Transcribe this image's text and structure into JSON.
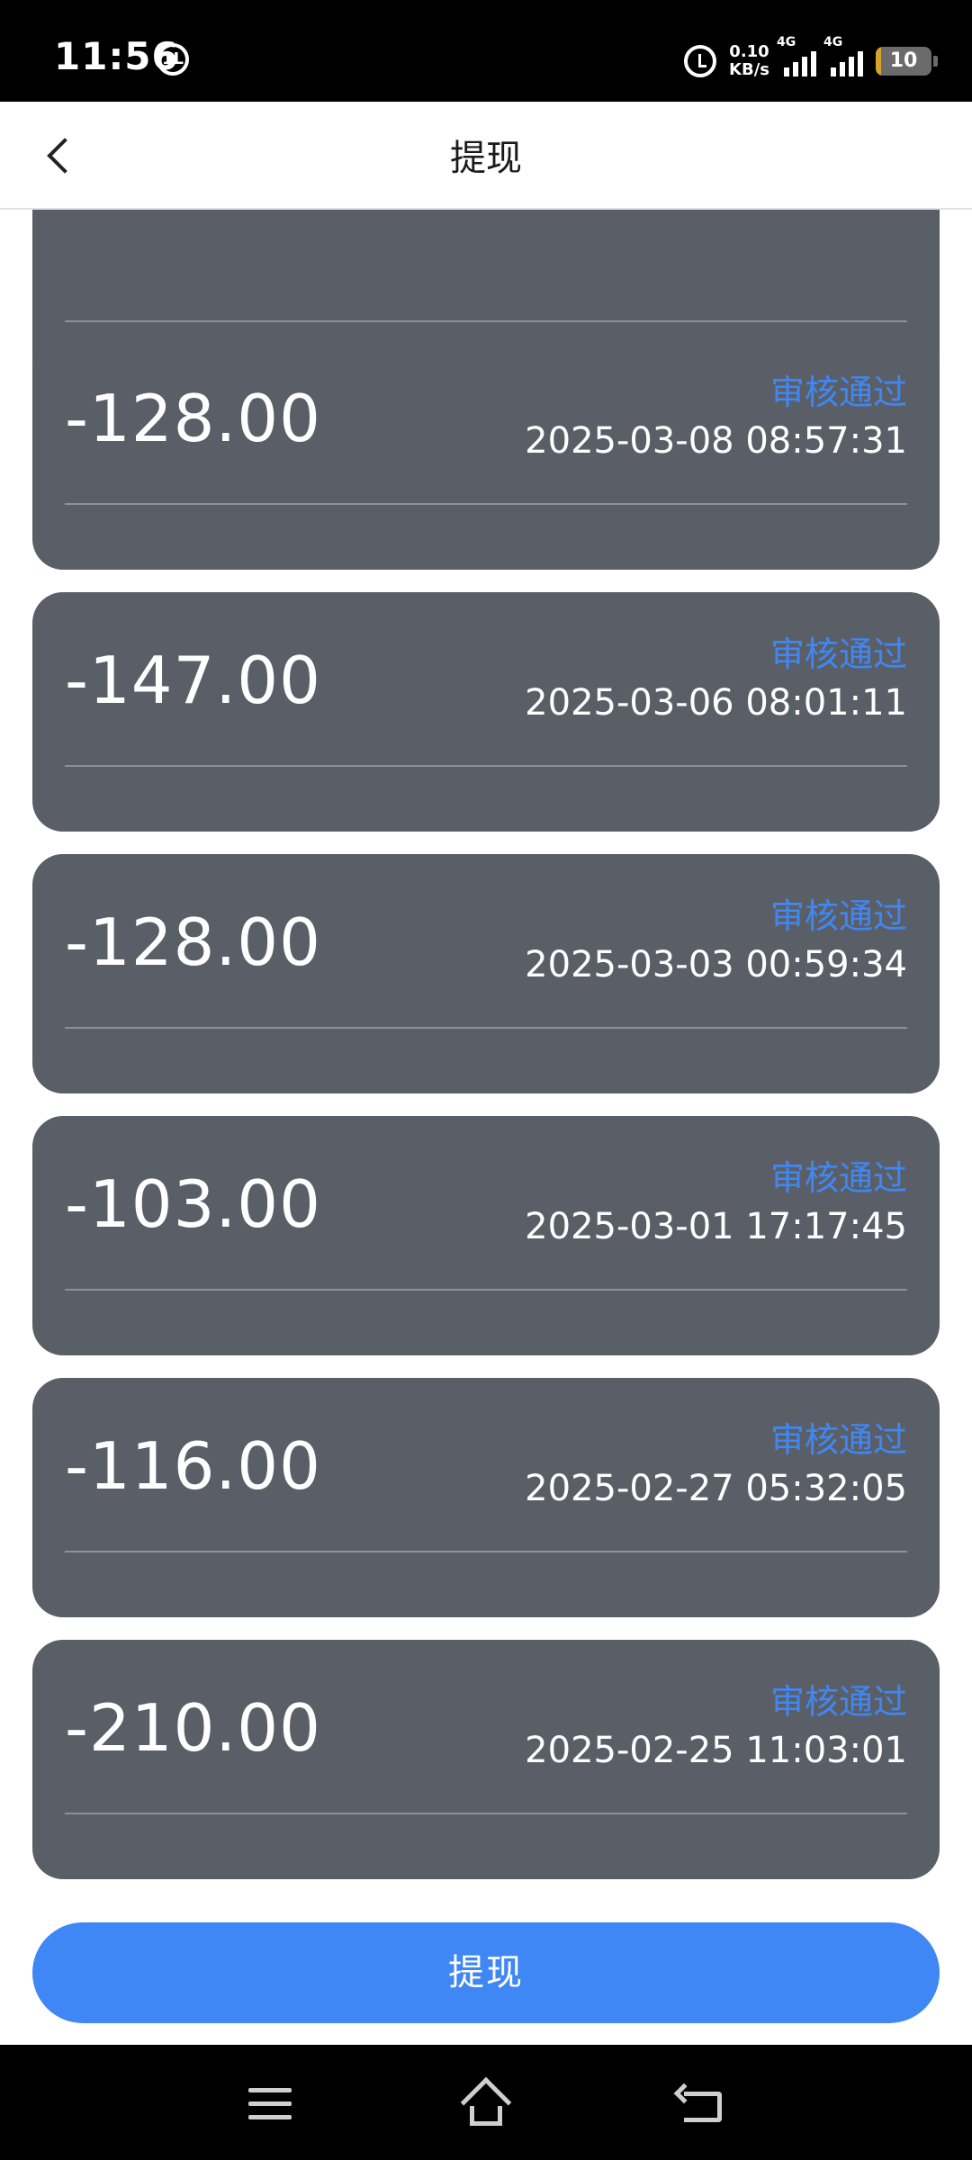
{
  "status_bar": {
    "time": "11:56",
    "notification_glyph": "1L",
    "net_speed_value": "0.10",
    "net_speed_unit": "KB/s",
    "sim1_label": "4G",
    "sim2_label": "4G",
    "battery_level": "10",
    "battery_fraction": 0.1
  },
  "header": {
    "title": "提现",
    "back_icon": "chevron-left-icon"
  },
  "records": [
    {
      "amount": "",
      "status": "",
      "datetime": ""
    },
    {
      "amount": "-128.00",
      "status": "审核通过",
      "datetime": "2025-03-08 08:57:31"
    },
    {
      "amount": "-147.00",
      "status": "审核通过",
      "datetime": "2025-03-06 08:01:11"
    },
    {
      "amount": "-128.00",
      "status": "审核通过",
      "datetime": "2025-03-03 00:59:34"
    },
    {
      "amount": "-103.00",
      "status": "审核通过",
      "datetime": "2025-03-01 17:17:45"
    },
    {
      "amount": "-116.00",
      "status": "审核通过",
      "datetime": "2025-02-27 05:32:05"
    },
    {
      "amount": "-210.00",
      "status": "审核通过",
      "datetime": "2025-02-25 11:03:01"
    }
  ],
  "actions": {
    "withdraw_label": "提现"
  },
  "nav_bar": {
    "menu_icon": "menu-icon",
    "home_icon": "home-icon",
    "back_icon": "back-icon"
  },
  "colors": {
    "card_background": "#5a5f67",
    "accent_blue": "#3f87f5",
    "status_bar_background": "#000000"
  }
}
